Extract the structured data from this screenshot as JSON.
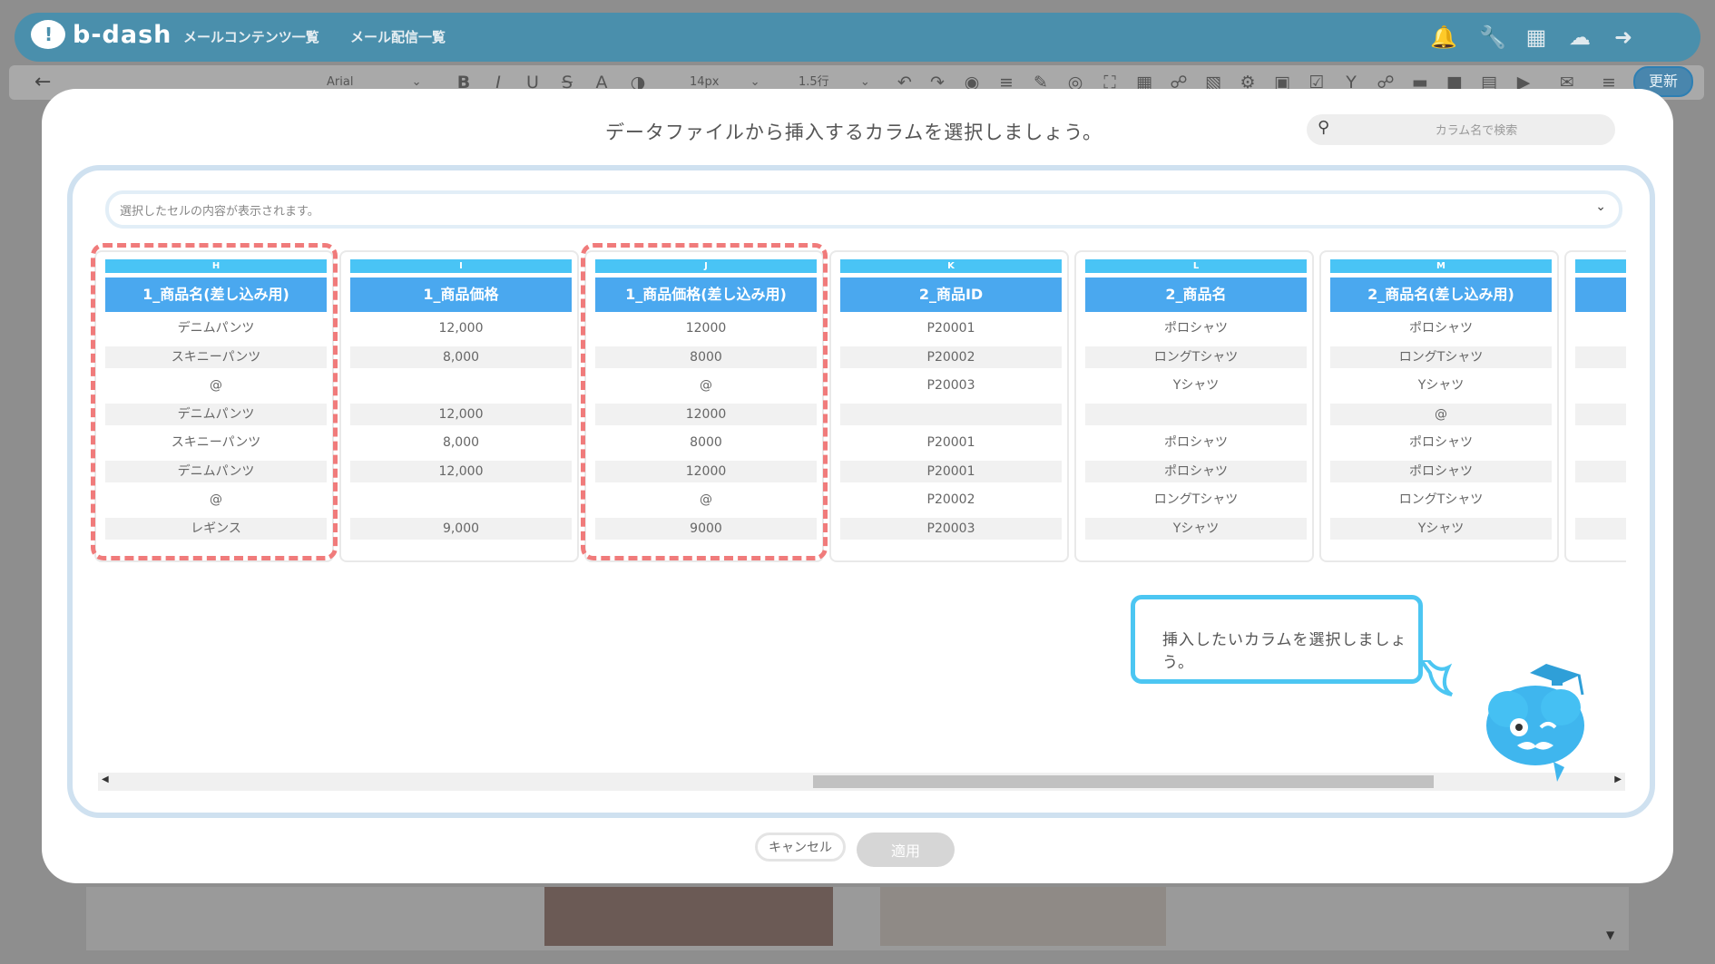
{
  "app": {
    "logo_text": "b-dash",
    "logo_mark": "!",
    "nav": [
      "メールコンテンツ一覧",
      "メール配信一覧"
    ]
  },
  "toolbar": {
    "font": "Arial",
    "size": "14px",
    "line_height": "1.5行",
    "update_label": "更新"
  },
  "modal": {
    "title": "データファイルから挿入するカラムを選択しましょう。",
    "search_placeholder": "カラム名で検索",
    "cell_preview_placeholder": "選択したセルの内容が表示されます。",
    "cancel_label": "キャンセル",
    "apply_label": "適用",
    "hint": "挿入したいカラムを選択しましょう。"
  },
  "columns": [
    {
      "letter": "H",
      "header": "1_商品名(差し込み用)",
      "cells": [
        "デニムパンツ",
        "スキニーパンツ",
        "@",
        "デニムパンツ",
        "スキニーパンツ",
        "デニムパンツ",
        "@",
        "レギンス"
      ]
    },
    {
      "letter": "I",
      "header": "1_商品価格",
      "cells": [
        "12,000",
        "8,000",
        "",
        "12,000",
        "8,000",
        "12,000",
        "",
        "9,000"
      ]
    },
    {
      "letter": "J",
      "header": "1_商品価格(差し込み用)",
      "cells": [
        "12000",
        "8000",
        "@",
        "12000",
        "8000",
        "12000",
        "@",
        "9000"
      ]
    },
    {
      "letter": "K",
      "header": "2_商品ID",
      "cells": [
        "P20001",
        "P20002",
        "P20003",
        "",
        "P20001",
        "P20001",
        "P20002",
        "P20003"
      ]
    },
    {
      "letter": "L",
      "header": "2_商品名",
      "cells": [
        "ポロシャツ",
        "ロングTシャツ",
        "Yシャツ",
        "",
        "ポロシャツ",
        "ポロシャツ",
        "ロングTシャツ",
        "Yシャツ"
      ]
    },
    {
      "letter": "M",
      "header": "2_商品名(差し込み用)",
      "cells": [
        "ポロシャツ",
        "ロングTシャツ",
        "Yシャツ",
        "@",
        "ポロシャツ",
        "ポロシャツ",
        "ロングTシャツ",
        "Yシャツ"
      ]
    },
    {
      "letter": "",
      "header": "",
      "cells": [
        "",
        "",
        "",
        "",
        "",
        "",
        "",
        ""
      ]
    }
  ]
}
